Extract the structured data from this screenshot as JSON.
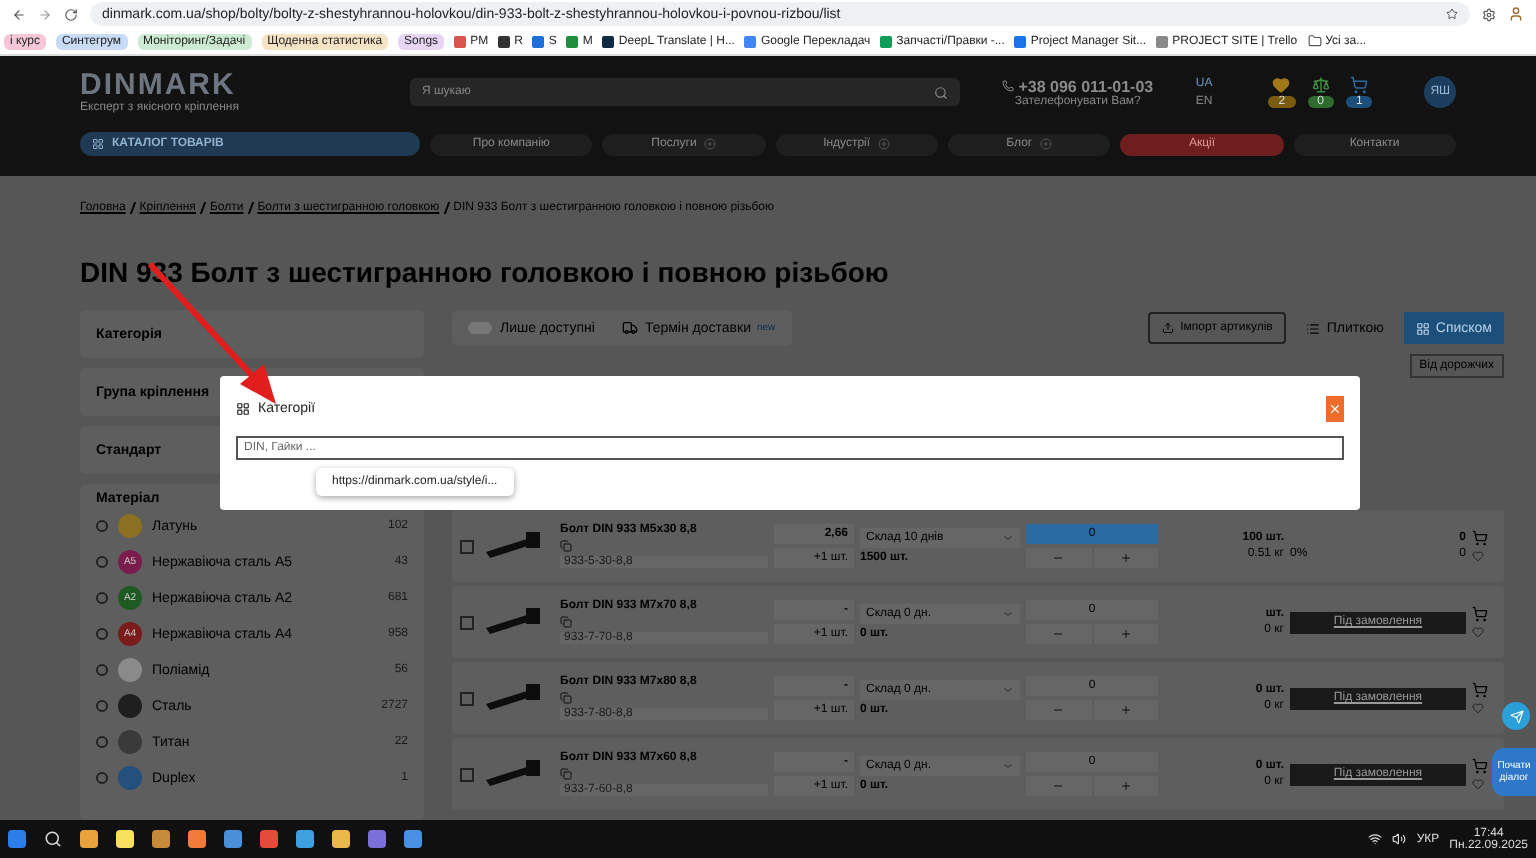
{
  "browser": {
    "url": "dinmark.com.ua/shop/bolty/bolty-z-shestyhrannou-holovkou/din-933-bolt-z-shestyhrannou-holovkou-i-povnou-rizbou/list",
    "bookmarks": [
      {
        "label": "і курс",
        "kind": "chip",
        "color": "#f4c6d7"
      },
      {
        "label": "Синтегрум",
        "kind": "chip",
        "color": "#c9dcf7"
      },
      {
        "label": "Моніторинг/Задачі",
        "kind": "chip",
        "color": "#cdebd2"
      },
      {
        "label": "Щоденна статистика",
        "kind": "chip",
        "color": "#f6e2c4"
      },
      {
        "label": "Songs",
        "kind": "chip",
        "color": "#e6d5f5"
      },
      {
        "label": "PM",
        "kind": "link",
        "color": "#d9534f"
      },
      {
        "label": "R",
        "kind": "link",
        "color": "#333333"
      },
      {
        "label": "S",
        "kind": "link",
        "color": "#1e6fd9"
      },
      {
        "label": "M",
        "kind": "link",
        "color": "#1e8e3e"
      },
      {
        "label": "DeepL Translate | H...",
        "kind": "link",
        "color": "#0f2b46"
      },
      {
        "label": "Google Перекладач",
        "kind": "link",
        "color": "#4285f4"
      },
      {
        "label": "Запчасті/Правки -...",
        "kind": "link",
        "color": "#0f9d58"
      },
      {
        "label": "Project Manager Sit...",
        "kind": "link",
        "color": "#1a73e8"
      },
      {
        "label": "PROJECT SITE | Trello",
        "kind": "link",
        "color": "#888888"
      },
      {
        "label": "Усі за...",
        "kind": "folder",
        "color": "#555555"
      }
    ]
  },
  "header": {
    "logo": "DINMARK",
    "tagline": "Експерт з якісного кріплення",
    "search_placeholder": "Я шукаю",
    "phone": "+38 096 011-01-03",
    "callback": "Зателефонувати Вам?",
    "languages": [
      {
        "label": "UA",
        "selected": true
      },
      {
        "label": "EN",
        "selected": false
      }
    ],
    "counters": [
      {
        "kind": "favorites",
        "count": "2",
        "color": "#7a5c10"
      },
      {
        "kind": "compare",
        "count": "0",
        "color": "#2f6b2f"
      },
      {
        "kind": "cart",
        "count": "1",
        "color": "#1c4f7a"
      }
    ],
    "avatar": "ЯШ"
  },
  "nav": {
    "catalog": "КАТАЛОГ ТОВАРІВ",
    "items": [
      {
        "label": "Про компанію",
        "kind": "plain"
      },
      {
        "label": "Послуги",
        "kind": "menu"
      },
      {
        "label": "Індустрії",
        "kind": "menu"
      },
      {
        "label": "Блог",
        "kind": "menu"
      },
      {
        "label": "Акції",
        "kind": "promo"
      },
      {
        "label": "Контакти",
        "kind": "plain"
      }
    ]
  },
  "breadcrumb": [
    "Головна",
    "Кріплення",
    "Болти",
    "Болти з шестигранною головкою",
    "DIN 933 Болт з шестигранною головкою і повною різьбою"
  ],
  "title": "DIN 933 Болт з шестигранною головкою і повною різьбою",
  "filters": [
    "Категорія",
    "Група кріплення",
    "Стандарт"
  ],
  "material": {
    "label": "Матеріал",
    "items": [
      {
        "name": "Латунь",
        "count": "102",
        "color": "#8a7020",
        "selected": false
      },
      {
        "name": "Нержавіюча сталь А5",
        "count": "43",
        "badge": "A5",
        "color": "#7a1d4c",
        "selected": false
      },
      {
        "name": "Нержавіюча сталь А2",
        "count": "681",
        "badge": "A2",
        "color": "#1e5a22",
        "selected": false
      },
      {
        "name": "Нержавіюча сталь А4",
        "count": "958",
        "badge": "A4",
        "color": "#7a1c1c",
        "selected": false
      },
      {
        "name": "Поліамід",
        "count": "56",
        "color": "#8a8a8a",
        "selected": false
      },
      {
        "name": "Сталь",
        "count": "2727",
        "color": "#1f1f1f",
        "selected": false
      },
      {
        "name": "Титан",
        "count": "22",
        "color": "#3a3a3a",
        "selected": false
      },
      {
        "name": "Duplex",
        "count": "1",
        "color": "#23507c",
        "selected": false
      }
    ]
  },
  "toolbar": {
    "available": {
      "label": "Лише доступні",
      "on": false
    },
    "delivery": {
      "label": "Термін доставки",
      "badge": "new"
    },
    "import": "Імпорт артикулів",
    "views": [
      {
        "label": "Плиткою",
        "selected": false,
        "kind": "list"
      },
      {
        "label": "Списком",
        "selected": true,
        "kind": "grid"
      }
    ],
    "sort": "Від дорожчих"
  },
  "products": [
    {
      "kind": "stock",
      "name": "Болт DIN 933 M5x30 8,8",
      "article": "933-5-30-8,8",
      "checked": false,
      "price": "2,66",
      "step": "+1 шт.",
      "warehouse": "Склад 10 днів",
      "available": "1500 шт.",
      "qty": "0",
      "stock": "100 шт.",
      "weight": "0.51 кг",
      "discount": "0%",
      "sum": "0",
      "sum2": "0"
    },
    {
      "kind": "order",
      "name": "Болт DIN 933 M7x70 8,8",
      "article": "933-7-70-8,8",
      "checked": false,
      "price": "-",
      "step": "+1 шт.",
      "warehouse": "Склад 0 дн.",
      "available": "0 шт.",
      "qty": "0",
      "stock": "шт.",
      "weight": "0 кг",
      "order_label": "Під замовлення"
    },
    {
      "kind": "order",
      "name": "Болт DIN 933 M7x80 8,8",
      "article": "933-7-80-8,8",
      "checked": false,
      "price": "-",
      "step": "+1 шт.",
      "warehouse": "Склад 0 дн.",
      "available": "0 шт.",
      "qty": "0",
      "stock": "0 шт.",
      "weight": "0 кг",
      "order_label": "Під замовлення"
    },
    {
      "kind": "order",
      "name": "Болт DIN 933 M7x60 8,8",
      "article": "933-7-60-8,8",
      "checked": false,
      "price": "-",
      "step": "+1 шт.",
      "warehouse": "Склад 0 дн.",
      "available": "0 шт.",
      "qty": "0",
      "stock": "0 шт.",
      "weight": "0 кг",
      "order_label": "Під замовлення"
    }
  ],
  "modal": {
    "title": "Категорії",
    "placeholder": "DIN, Гайки ...",
    "tooltip": "https://dinmark.com.ua/style/i..."
  },
  "chat": {
    "label": "Почати діалог"
  },
  "taskbar": {
    "lang": "УКР",
    "time": "17:44",
    "date": "Пн.22.09.2025"
  }
}
